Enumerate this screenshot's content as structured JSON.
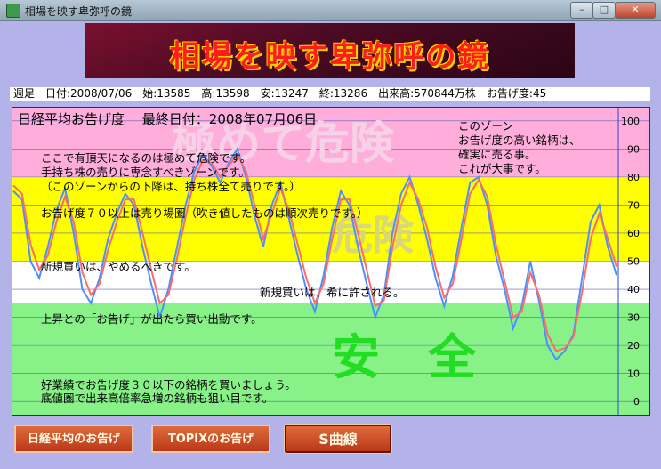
{
  "window": {
    "title": "相場を映す卑弥呼の鏡",
    "min_symbol": "–",
    "max_symbol": "□",
    "close_symbol": "✕"
  },
  "banner": {
    "text": "相場を映す卑弥呼の鏡"
  },
  "stats": {
    "text": "週足　日付:2008/07/06　始:13585　高:13598　安:13247　終:13286　出来高:570844万株　お告げ度:45"
  },
  "chart": {
    "title": "日経平均お告げ度　 最終日付：2008年07月06日",
    "watermark_danger": "極めて危険",
    "watermark_danger2": "危険",
    "watermark_safe": "安　全",
    "notes": {
      "top_right": [
        "このゾーン",
        "お告げ度の高い銘柄は、",
        "確実に売る事。",
        "これが大事です。"
      ],
      "pink": [
        "ここで有頂天になるのは極めて危険です。",
        "手持ち株の売りに専念すべきゾーンです。",
        "（このゾーンからの下降は、持ち株全て売りです。）"
      ],
      "yellow": [
        "お告げ度７０以上は売り場圏（吹き値したものは順次売りです。）",
        "新規買いは、やめるべきです。"
      ],
      "white": [
        "新規買いは、希に許される。"
      ],
      "green": [
        "上昇との「お告げ」が出たら買い出動です。",
        "好業績でお告げ度３０以下の銘柄を買いましょう。",
        "底値圏で出来高倍率急増の銘柄も狙い目です。"
      ]
    }
  },
  "chart_data": {
    "type": "line",
    "ylim": [
      -5,
      105
    ],
    "yticks": [
      "100",
      "90",
      "80",
      "70",
      "60",
      "50",
      "40",
      "30",
      "20",
      "10",
      "0"
    ],
    "zones": [
      {
        "name": "extreme-danger",
        "from": 80,
        "to": 105,
        "color": "#ffaedb"
      },
      {
        "name": "danger",
        "from": 50,
        "to": 80,
        "color": "#ffff00"
      },
      {
        "name": "neutral",
        "from": 35,
        "to": 50,
        "color": "#ffffff"
      },
      {
        "name": "safe",
        "from": -5,
        "to": 35,
        "color": "#88f288"
      }
    ],
    "series": [
      {
        "color": "#4a90ff",
        "values": [
          75,
          72,
          50,
          44,
          55,
          68,
          76,
          60,
          40,
          35,
          44,
          58,
          67,
          74,
          70,
          55,
          42,
          30,
          40,
          55,
          70,
          82,
          88,
          84,
          78,
          85,
          90,
          80,
          66,
          55,
          70,
          78,
          65,
          52,
          40,
          32,
          45,
          62,
          75,
          70,
          55,
          42,
          30,
          38,
          60,
          74,
          80,
          70,
          58,
          44,
          34,
          45,
          62,
          78,
          80,
          70,
          52,
          40,
          26,
          34,
          50,
          36,
          20,
          15,
          18,
          24,
          44,
          64,
          70,
          55,
          45
        ]
      },
      {
        "color": "#ff6a6a",
        "values": [
          77,
          74,
          56,
          47,
          52,
          64,
          73,
          64,
          46,
          38,
          42,
          54,
          64,
          72,
          72,
          60,
          47,
          35,
          38,
          51,
          66,
          79,
          86,
          85,
          80,
          84,
          88,
          82,
          70,
          58,
          67,
          76,
          68,
          56,
          44,
          35,
          42,
          58,
          72,
          72,
          60,
          47,
          34,
          36,
          55,
          70,
          78,
          72,
          62,
          48,
          37,
          42,
          58,
          74,
          79,
          73,
          56,
          43,
          30,
          32,
          46,
          38,
          24,
          18,
          19,
          23,
          39,
          58,
          67,
          58,
          48
        ]
      }
    ]
  },
  "buttons": {
    "nikkei": "日経平均のお告げ",
    "topix": "TOPIXのお告げ",
    "scurve": "S曲線"
  }
}
